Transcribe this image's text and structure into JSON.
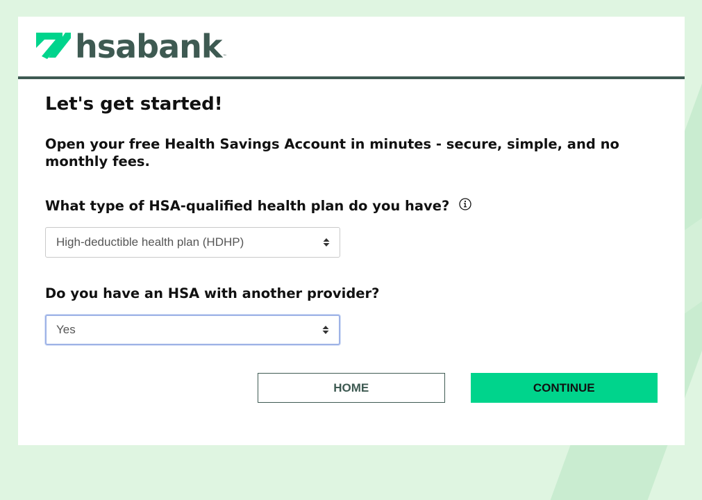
{
  "brand": {
    "name": "hsabank",
    "trademark": "™",
    "colors": {
      "primary": "#3e5a52",
      "accent": "#00d48c",
      "background": "#dff5e1"
    }
  },
  "page": {
    "title": "Let's get started!",
    "subtitle": "Open your free Health Savings Account in minutes - secure, simple, and no monthly fees."
  },
  "questions": [
    {
      "label": "What type of HSA-qualified health plan do you have?",
      "info_icon": "info-circle-icon",
      "selected": "High-deductible health plan (HDHP)"
    },
    {
      "label": "Do you have an HSA with another provider?",
      "selected": "Yes"
    }
  ],
  "buttons": {
    "home": "HOME",
    "continue": "CONTINUE"
  }
}
